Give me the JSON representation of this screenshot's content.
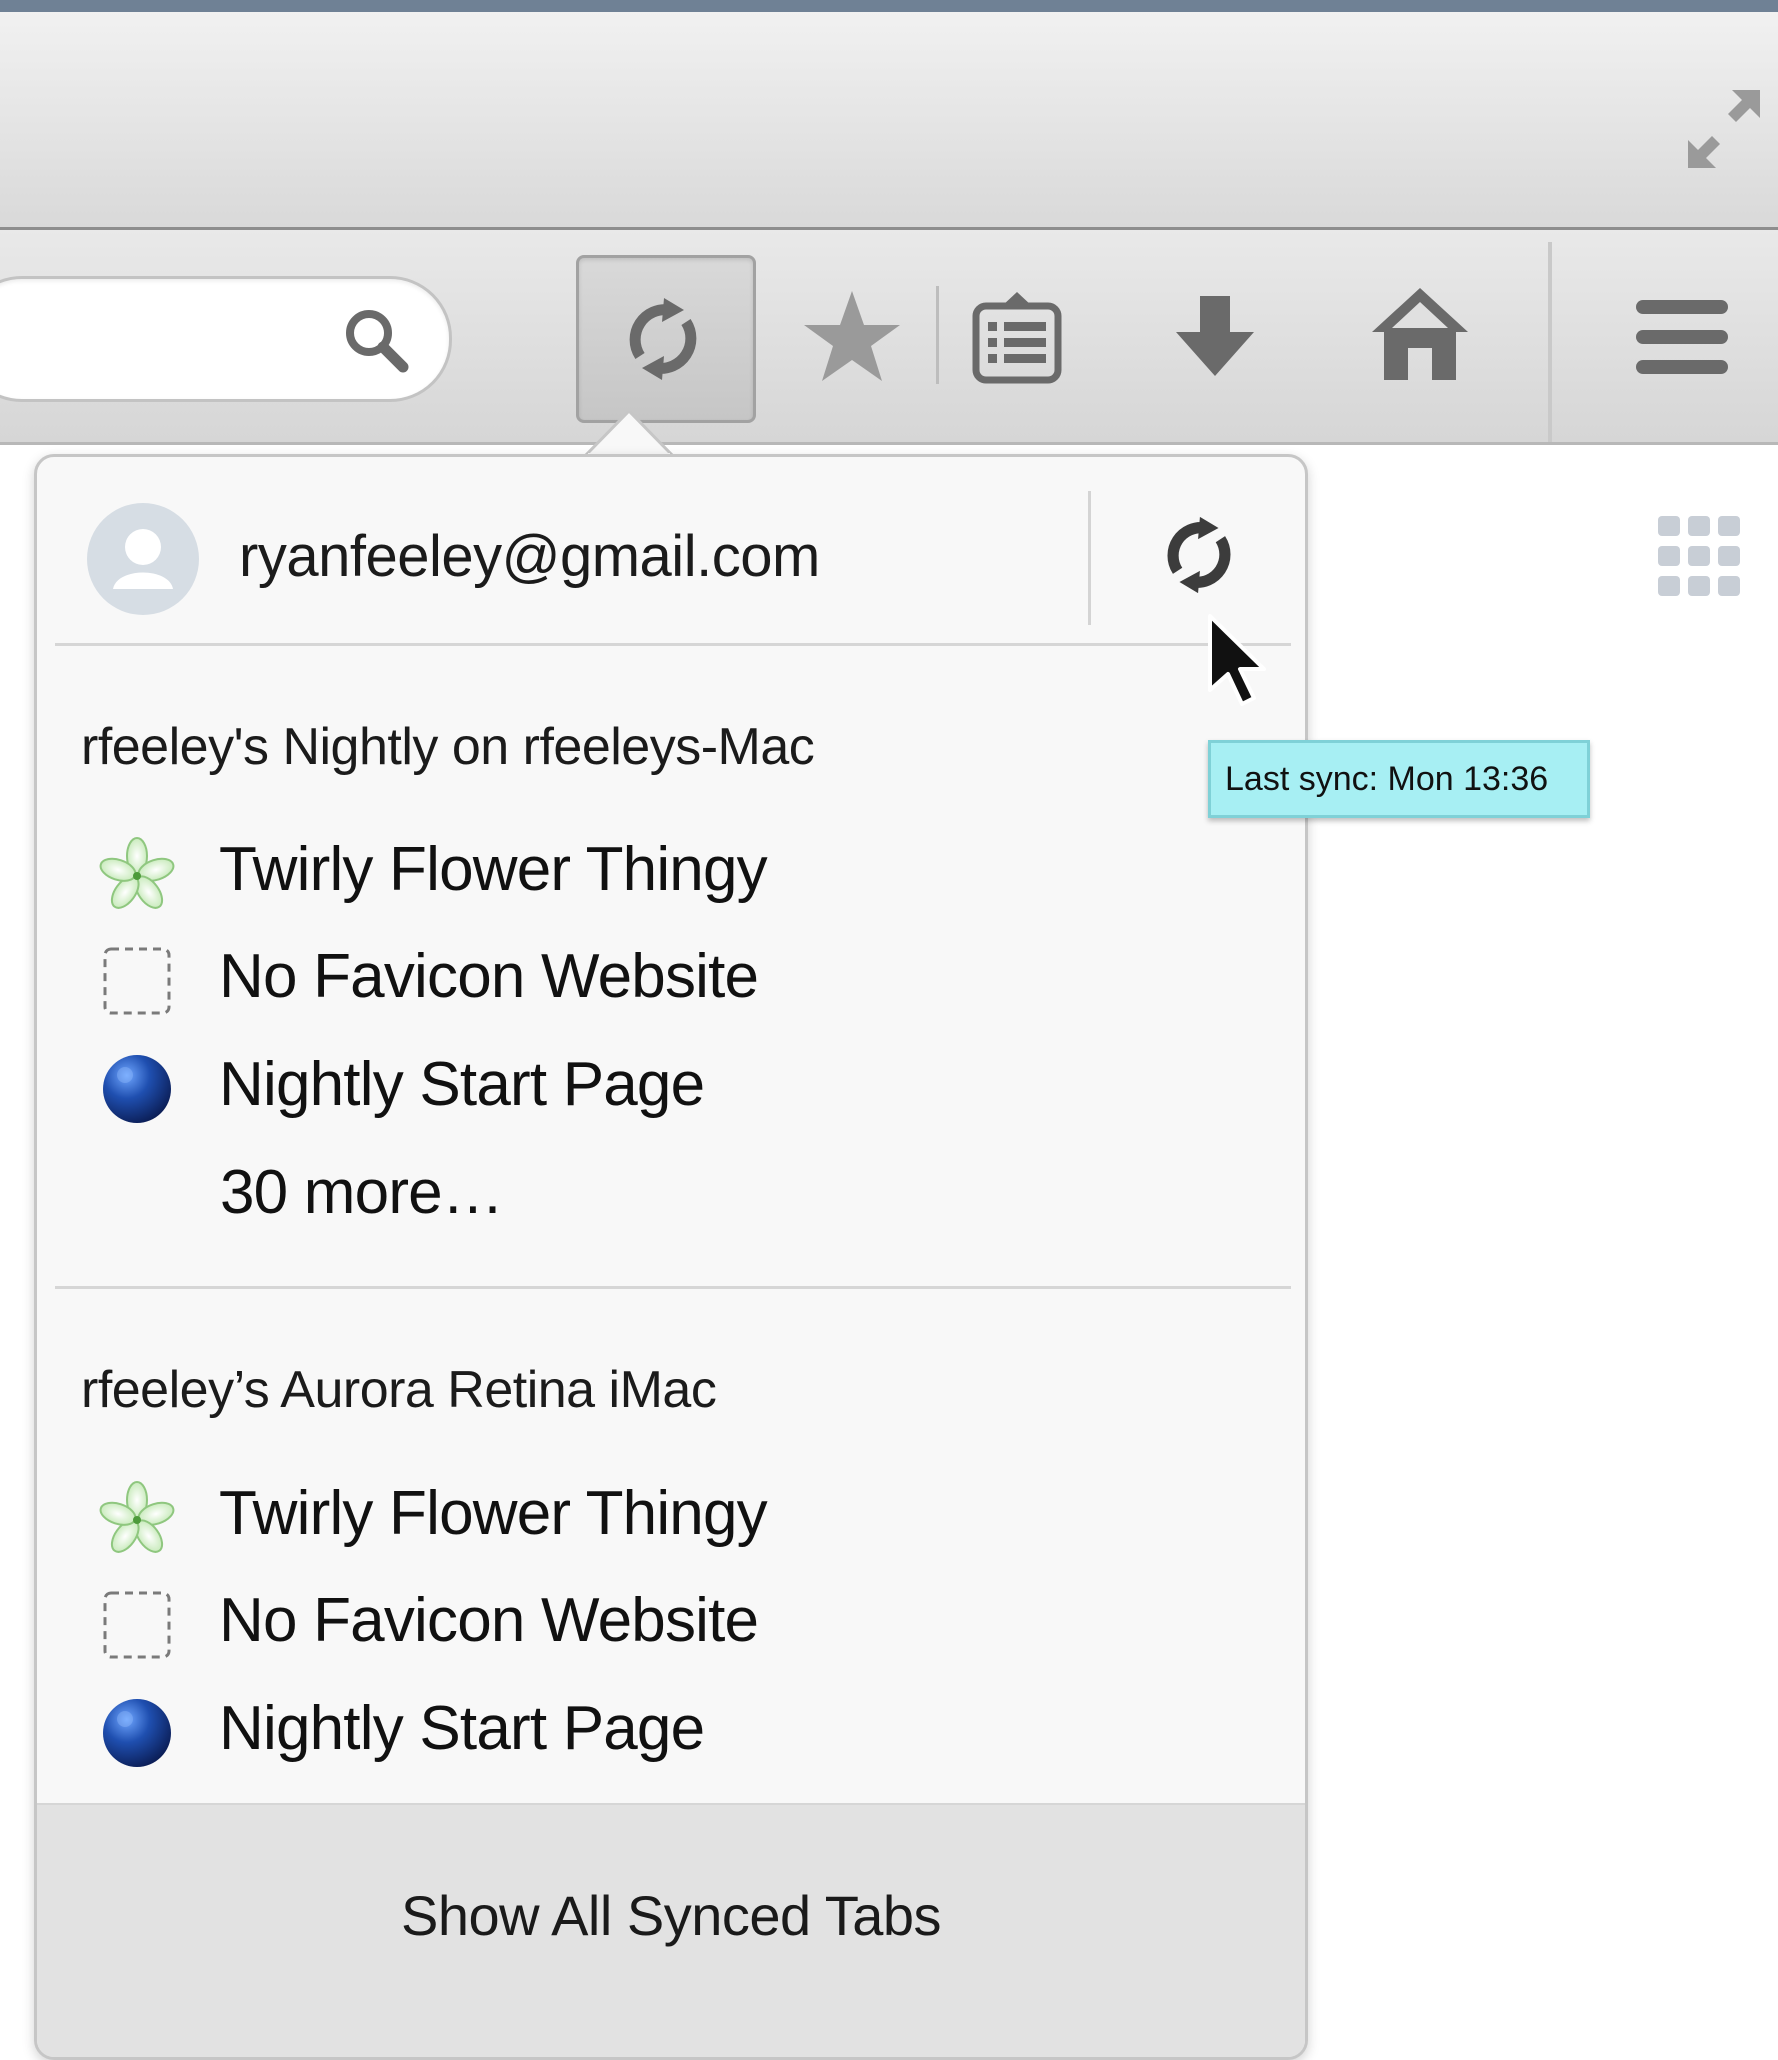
{
  "account": {
    "email": "ryanfeeley@gmail.com"
  },
  "tooltip": {
    "text": "Last sync: Mon 13:36"
  },
  "devices": [
    {
      "name": "rfeeley's Nightly on rfeeleys-Mac",
      "tabs": [
        {
          "title": "Twirly Flower Thingy",
          "icon": "flower-icon"
        },
        {
          "title": "No Favicon Website",
          "icon": "blank-favicon-icon"
        },
        {
          "title": "Nightly Start Page",
          "icon": "nightly-globe-icon"
        }
      ],
      "more_label": "30 more…"
    },
    {
      "name": "rfeeley’s Aurora Retina iMac",
      "tabs": [
        {
          "title": "Twirly Flower Thingy",
          "icon": "flower-icon"
        },
        {
          "title": "No Favicon Website",
          "icon": "blank-favicon-icon"
        },
        {
          "title": "Nightly Start Page",
          "icon": "nightly-globe-icon"
        }
      ]
    }
  ],
  "footer": {
    "show_all_label": "Show All Synced Tabs"
  },
  "colors": {
    "tooltip_bg": "#a7eff3",
    "panel_bg": "#f8f8f8",
    "footer_bg": "#e2e2e2",
    "globe_blue": "#1f3f8f"
  }
}
